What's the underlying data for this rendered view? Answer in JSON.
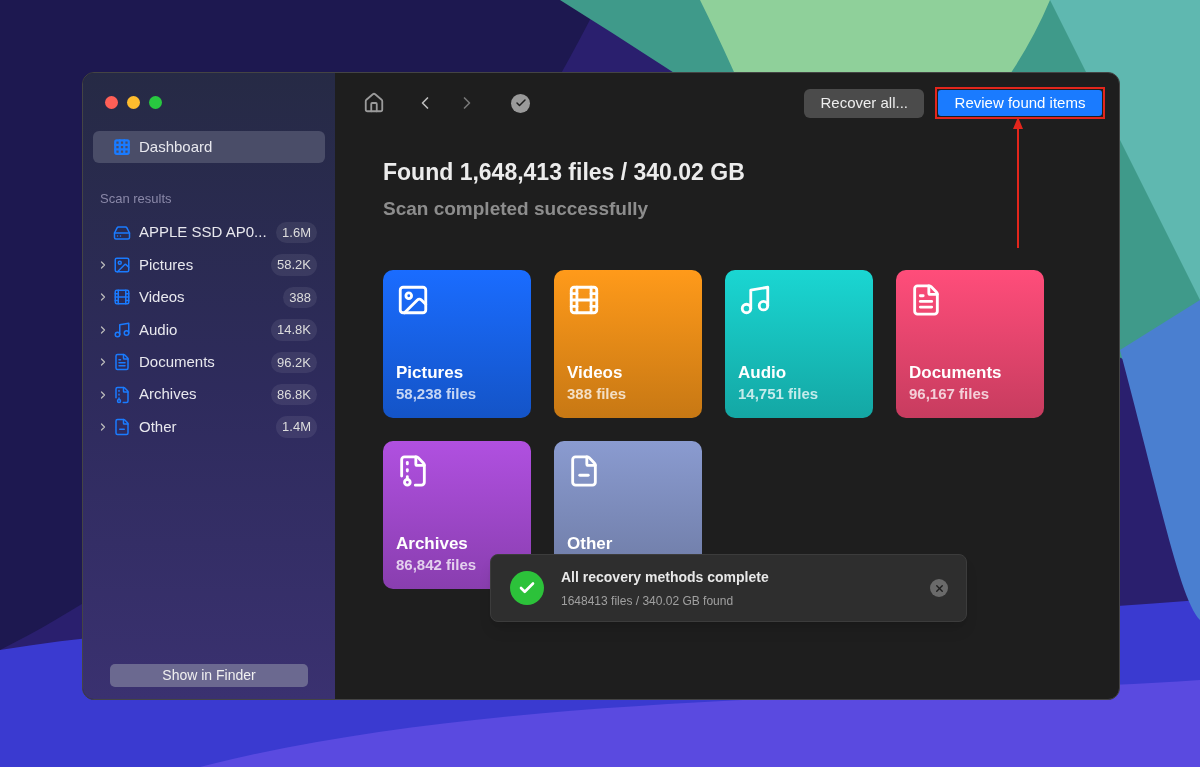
{
  "sidebar": {
    "dashboard": {
      "label": "Dashboard",
      "selected": true
    },
    "section_title": "Scan results",
    "items": [
      {
        "kind": "drive",
        "label": "APPLE SSD AP0...",
        "count": "1.6M"
      },
      {
        "kind": "pictures",
        "label": "Pictures",
        "count": "58.2K",
        "expanded": false
      },
      {
        "kind": "videos",
        "label": "Videos",
        "count": "388",
        "expanded": false
      },
      {
        "kind": "audio",
        "label": "Audio",
        "count": "14.8K",
        "expanded": false
      },
      {
        "kind": "documents",
        "label": "Documents",
        "count": "96.2K",
        "expanded": false
      },
      {
        "kind": "archives",
        "label": "Archives",
        "count": "86.8K",
        "expanded": false
      },
      {
        "kind": "other",
        "label": "Other",
        "count": "1.4M",
        "expanded": false
      }
    ],
    "footer_button": "Show in Finder"
  },
  "toolbar": {
    "recover_button": "Recover all...",
    "review_button": "Review found items"
  },
  "summary": {
    "title": "Found 1,648,413 files / 340.02 GB",
    "subtitle": "Scan completed successfully"
  },
  "categories": [
    {
      "kind": "pictures",
      "label": "Pictures",
      "count": "58,238 files",
      "color": "#1a6cff"
    },
    {
      "kind": "videos",
      "label": "Videos",
      "count": "388 files",
      "color": "#ff9a1a"
    },
    {
      "kind": "audio",
      "label": "Audio",
      "count": "14,751 files",
      "color": "#1ad6d2"
    },
    {
      "kind": "documents",
      "label": "Documents",
      "count": "96,167 files",
      "color": "#ff4d7a"
    },
    {
      "kind": "archives",
      "label": "Archives",
      "count": "86,842 files",
      "color": "#b050e0"
    },
    {
      "kind": "other",
      "label": "Other",
      "color": "#8a9bd0"
    }
  ],
  "toast": {
    "title": "All recovery methods complete",
    "message": "1648413 files / 340.02 GB found"
  }
}
